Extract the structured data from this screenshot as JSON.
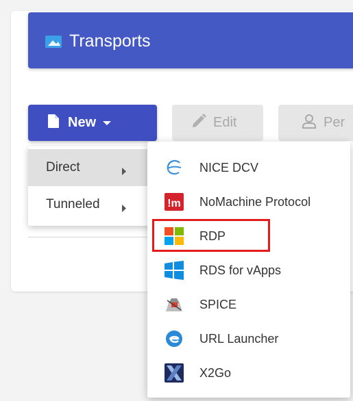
{
  "header": {
    "title": "Transports",
    "icon": "transport-window-icon",
    "color": "#4559c4"
  },
  "toolbar": {
    "new_label": "New",
    "edit_label": "Edit",
    "permissions_label": "Per"
  },
  "menu": {
    "items": [
      {
        "label": "Direct",
        "active": true
      },
      {
        "label": "Tunneled",
        "active": false
      }
    ]
  },
  "submenu": {
    "items": [
      {
        "label": "NICE DCV",
        "icon": "nice-dcv-icon"
      },
      {
        "label": "NoMachine Protocol",
        "icon": "nomachine-icon"
      },
      {
        "label": "RDP",
        "icon": "windows-icon",
        "highlighted": true
      },
      {
        "label": "RDS for vApps",
        "icon": "windows-blue-icon"
      },
      {
        "label": "SPICE",
        "icon": "spice-icon"
      },
      {
        "label": "URL Launcher",
        "icon": "url-launcher-icon"
      },
      {
        "label": "X2Go",
        "icon": "x2go-icon"
      }
    ]
  },
  "colors": {
    "accent": "#3f4fc2",
    "highlight_border": "#e31b1b"
  }
}
